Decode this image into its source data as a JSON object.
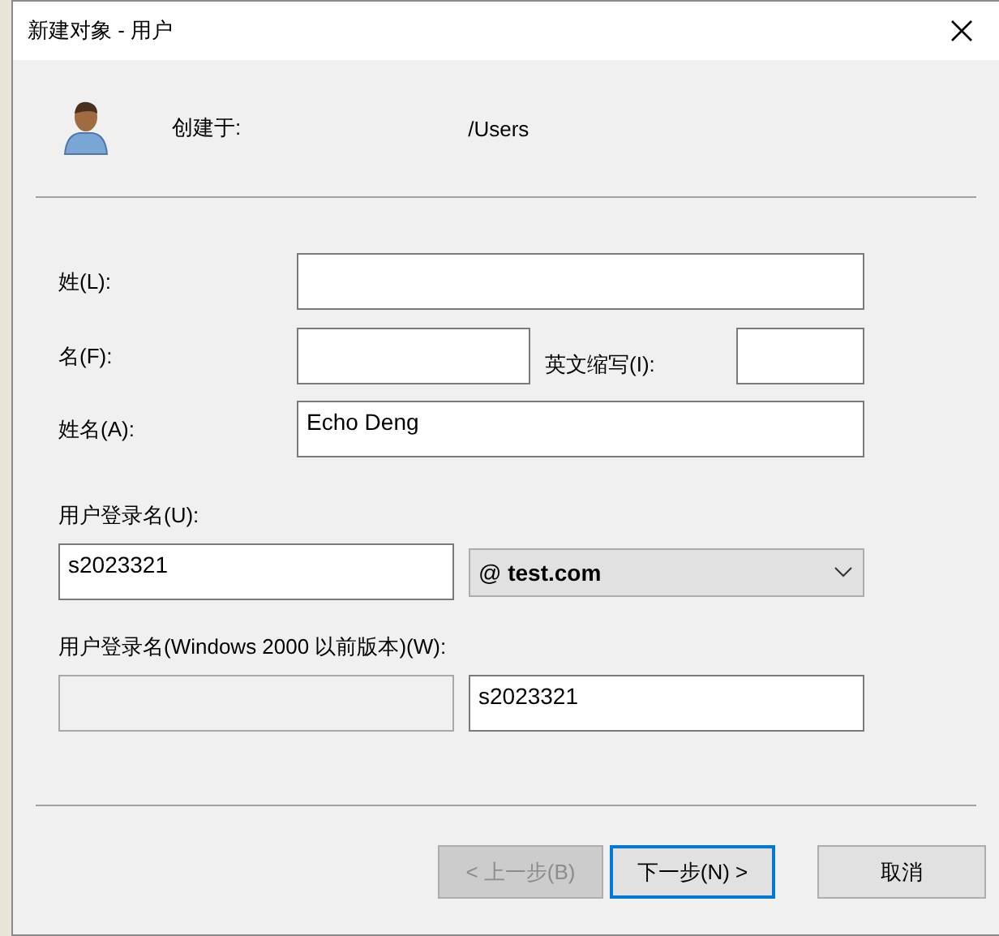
{
  "window": {
    "title": "新建对象 - 用户"
  },
  "header": {
    "created_in_label": "创建于:",
    "created_in_path": "/Users"
  },
  "name_fields": {
    "last_name": {
      "label": "姓(L):"
    },
    "first_name": {
      "label": "名(F):"
    },
    "initials": {
      "label": "英文缩写(I):"
    },
    "full_name": {
      "label": "姓名(A):",
      "value": "Echo Deng"
    }
  },
  "logon": {
    "label": "用户登录名(U):",
    "value": "s2023321",
    "domain": "@ **test.com**"
  },
  "legacy_logon": {
    "label": "用户登录名(Windows 2000 以前版本)(W):",
    "domain_disabled": true,
    "value": "s2023321"
  },
  "buttons": [
    {
      "label": "< 上一步(B)",
      "disabled": true,
      "default": false
    },
    {
      "label": "下一步(N) >",
      "disabled": false,
      "default": true
    },
    {
      "label": "取消",
      "disabled": false,
      "default": false
    }
  ]
}
